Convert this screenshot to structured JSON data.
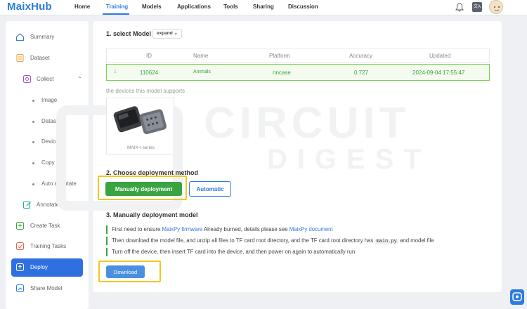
{
  "header": {
    "logo": "MaixHub",
    "nav": [
      {
        "label": "Home"
      },
      {
        "label": "Training",
        "active": true
      },
      {
        "label": "Models"
      },
      {
        "label": "Applications"
      },
      {
        "label": "Tools"
      },
      {
        "label": "Sharing"
      },
      {
        "label": "Discussion"
      }
    ],
    "lang_badge": "文A"
  },
  "sidebar": {
    "summary": "Summary",
    "dataset": "Dataset",
    "collect": "Collect",
    "image": "Image",
    "dataset_sub": "Dataset",
    "device": "Device",
    "copy": "Copy",
    "auto_annotate": "Auto annotate",
    "annotate": "Annotate",
    "create_task": "Create Task",
    "training_tasks": "Training Tasks",
    "deploy": "Deploy",
    "share_model": "Share Model"
  },
  "main": {
    "step1_title": "1. select Model",
    "expand_label": "expand ⌄",
    "table": {
      "headers": {
        "id": "ID",
        "name": "Name",
        "platform": "Platform",
        "accuracy": "Accuracy",
        "updated": "Updated"
      },
      "row": {
        "index": "1",
        "id": "110624",
        "name": "Animals",
        "platform": "nncase",
        "accuracy": "0.727",
        "updated": "2024-09-04 17:55:47"
      }
    },
    "supports_label": "the devices this model supports",
    "device_caption": "MAIX-I series",
    "step2_title": "2. Choose deployment method",
    "manual_button": "Manually deployment",
    "auto_button": "Automatic",
    "step3_title": "3. Manually deployment model",
    "steps": {
      "s1_pre": "First need to ensure ",
      "s1_link1": "MaixPy firmware",
      "s1_mid": " Already burned, details please see ",
      "s1_link2": "MaixPy document",
      "s2_pre": "Then download the model file, and unzip all files to TF card root directory, and the TF card root directory has ",
      "s2_code": "main.py",
      "s2_post": " and model file",
      "s3": "Turn off the device, then insert TF card into the device, and then power on again to automatically run"
    },
    "download_button": "Download"
  },
  "watermark": {
    "line1": "CIRCUIT",
    "line2": "DIGEST"
  },
  "colors": {
    "accent": "#2d7be0",
    "success": "#3aa342",
    "highlight": "#f4c61f"
  }
}
